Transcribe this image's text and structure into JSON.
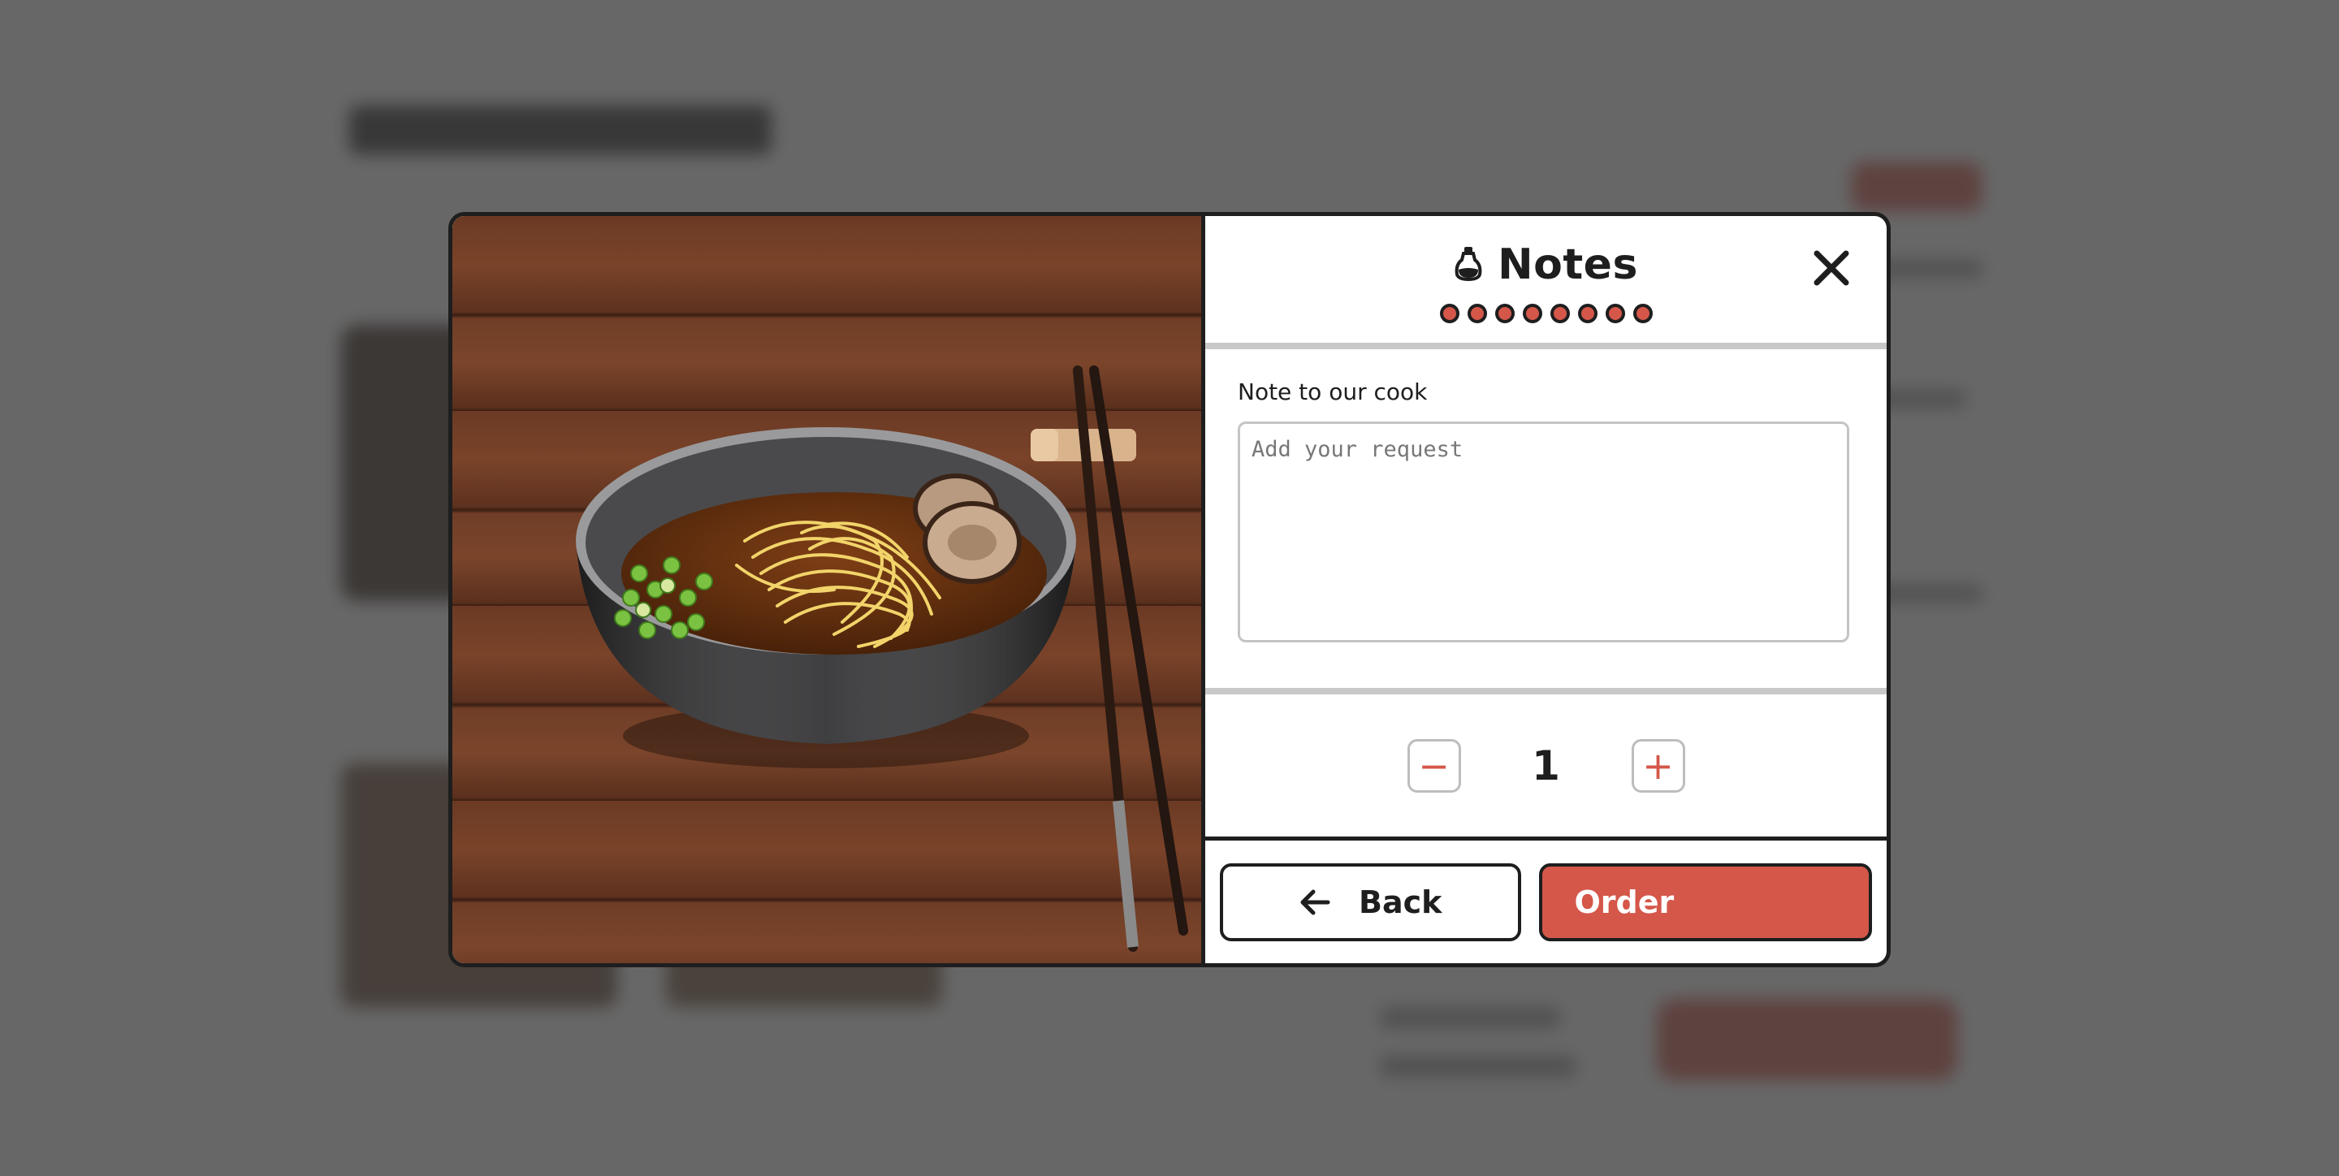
{
  "modal": {
    "title": "Notes",
    "step_dots": 8,
    "note": {
      "label": "Note to our cook",
      "placeholder": "Add your request",
      "value": ""
    },
    "quantity": {
      "value": "1",
      "decrement_symbol": "−",
      "increment_symbol": "+"
    },
    "actions": {
      "back_label": "Back",
      "order_label": "Order"
    },
    "icons": {
      "title": "soy-sauce-bottle-icon",
      "close": "close-icon",
      "back": "arrow-left-icon"
    }
  },
  "colors": {
    "accent": "#d4574a",
    "ink": "#1e1e1e",
    "divider": "#c8c8c8",
    "overlay": "#3c3c3c"
  }
}
